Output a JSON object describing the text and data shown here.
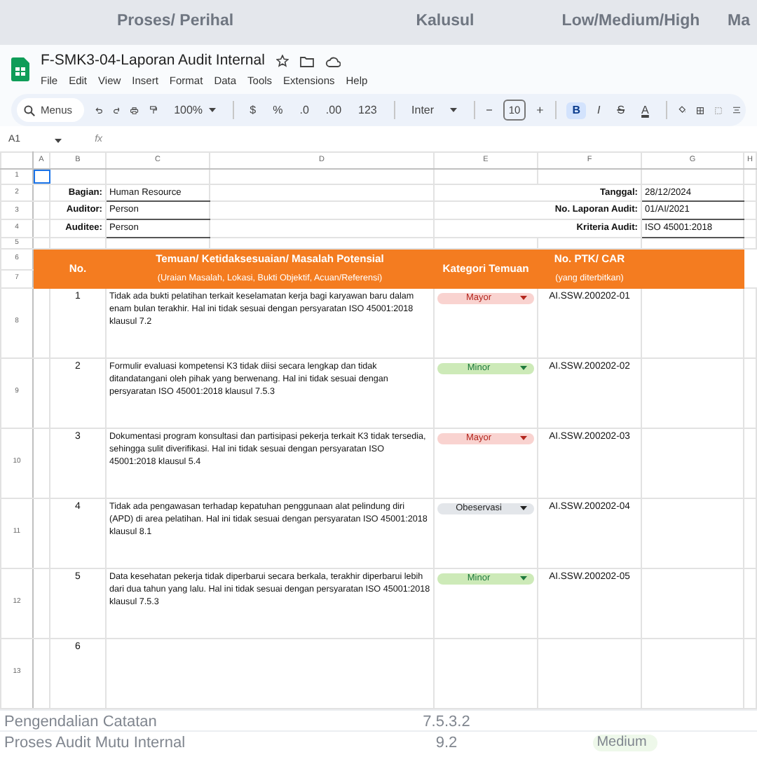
{
  "background_sheet": {
    "headers": [
      "Proses/ Perihal",
      "Kalusul",
      "Low/Medium/High",
      "Ma"
    ],
    "rows": [
      {
        "item": "Pengendalian Catatan",
        "clause": "7.5.3.2"
      },
      {
        "item": "Proses Audit Mutu Internal",
        "clause": "9.2",
        "level": "Medium"
      }
    ]
  },
  "document": {
    "title": "F-SMK3-04-Laporan Audit Internal",
    "menus": [
      "File",
      "Edit",
      "View",
      "Insert",
      "Format",
      "Data",
      "Tools",
      "Extensions",
      "Help"
    ]
  },
  "toolbar": {
    "search_placeholder": "Menus",
    "zoom": "100%",
    "number_formats": [
      "$",
      "%",
      ".0",
      ".00",
      "123"
    ],
    "font": "Inter",
    "font_size": "10",
    "text_styles": [
      {
        "label": "B",
        "selected": true
      },
      {
        "label": "I",
        "selected": false
      },
      {
        "label": "S",
        "selected": false
      },
      {
        "label": "A",
        "selected": false
      }
    ]
  },
  "formula_bar": {
    "cell_ref": "A1",
    "fx": "fx"
  },
  "columns": [
    "A",
    "B",
    "C",
    "D",
    "E",
    "F",
    "G",
    "H"
  ],
  "row_numbers": [
    "1",
    "2",
    "3",
    "4",
    "5",
    "6",
    "7",
    "8",
    "9",
    "10",
    "11",
    "12",
    "13"
  ],
  "info_left": [
    {
      "label": "Bagian:",
      "value": "Human Resource"
    },
    {
      "label": "Auditor:",
      "value": "Person"
    },
    {
      "label": "Auditee:",
      "value": "Person"
    }
  ],
  "info_right": [
    {
      "label": "Tanggal:",
      "value": "28/12/2024"
    },
    {
      "label": "No. Laporan Audit:",
      "value": "01/AI/2021"
    },
    {
      "label": "Kriteria Audit:",
      "value": "ISO 45001:2018"
    }
  ],
  "table_header": {
    "no": "No.",
    "finding": "Temuan/ Ketidaksesuaian/ Masalah Potensial",
    "finding_note": "(Uraian Masalah, Lokasi, Bukti Objektif, Acuan/Referensi)",
    "category": "Kategori Temuan",
    "ptk": "No. PTK/ CAR",
    "ptk_note": "(yang diterbitkan)"
  },
  "findings": [
    {
      "no": "1",
      "text": "Tidak ada bukti pelatihan terkait keselamatan kerja bagi karyawan baru dalam enam bulan terakhir. Hal ini tidak sesuai dengan persyaratan ISO 45001:2018 klausul 7.2",
      "category": {
        "label": "Mayor",
        "kind": "major"
      },
      "ptk": "AI.SSW.200202-01"
    },
    {
      "no": "2",
      "text": "Formulir evaluasi kompetensi K3 tidak diisi secara lengkap dan tidak ditandatangani oleh pihak yang berwenang. Hal ini tidak sesuai dengan persyaratan ISO 45001:2018 klausul 7.5.3",
      "category": {
        "label": "Minor",
        "kind": "minor"
      },
      "ptk": "AI.SSW.200202-02"
    },
    {
      "no": "3",
      "text": "Dokumentasi program konsultasi dan partisipasi pekerja terkait K3 tidak tersedia, sehingga sulit diverifikasi. Hal ini tidak sesuai dengan persyaratan ISO 45001:2018 klausul 5.4",
      "category": {
        "label": "Mayor",
        "kind": "major"
      },
      "ptk": "AI.SSW.200202-03"
    },
    {
      "no": "4",
      "text": "Tidak ada pengawasan terhadap kepatuhan penggunaan alat pelindung diri (APD) di area pelatihan. Hal ini tidak sesuai dengan persyaratan ISO 45001:2018 klausul 8.1",
      "category": {
        "label": "Obeservasi",
        "kind": "observation"
      },
      "ptk": "AI.SSW.200202-04"
    },
    {
      "no": "5",
      "text": "Data kesehatan pekerja tidak diperbarui secara berkala, terakhir diperbarui lebih dari dua tahun yang lalu. Hal ini tidak sesuai dengan persyaratan ISO 45001:2018 klausul 7.5.3",
      "category": {
        "label": "Minor",
        "kind": "minor"
      },
      "ptk": "AI.SSW.200202-05"
    },
    {
      "no": "6"
    }
  ]
}
